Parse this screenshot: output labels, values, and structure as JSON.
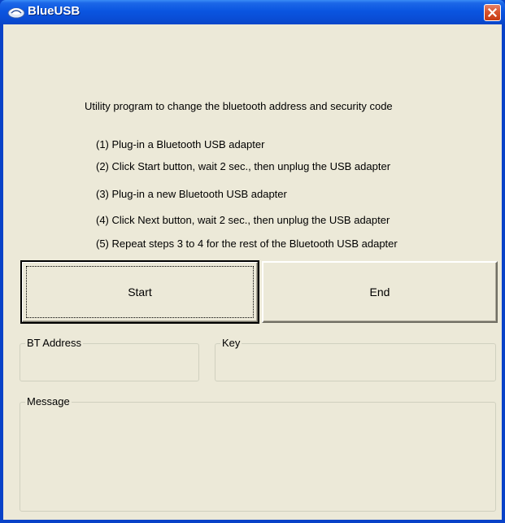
{
  "window": {
    "title": "BlueUSB",
    "icon": "bluetooth-app-icon",
    "titlebar_color": "#0a4fd8",
    "body_color": "#ece9d8"
  },
  "content": {
    "heading": "Utility program to change the bluetooth address and security code",
    "steps": [
      "(1) Plug-in a Bluetooth USB adapter",
      "(2) Click Start button, wait 2 sec., then unplug the USB adapter",
      "(3) Plug-in a new Bluetooth USB adapter",
      "(4) Click Next button, wait 2 sec., then  unplug the USB adapter",
      "(5) Repeat steps 3 to 4 for the rest of the Bluetooth  USB adapter"
    ]
  },
  "buttons": {
    "start": "Start",
    "end": "End"
  },
  "groups": {
    "bt_address": {
      "label": "BT Address",
      "value": ""
    },
    "key": {
      "label": "Key",
      "value": ""
    },
    "message": {
      "label": "Message",
      "value": ""
    }
  }
}
